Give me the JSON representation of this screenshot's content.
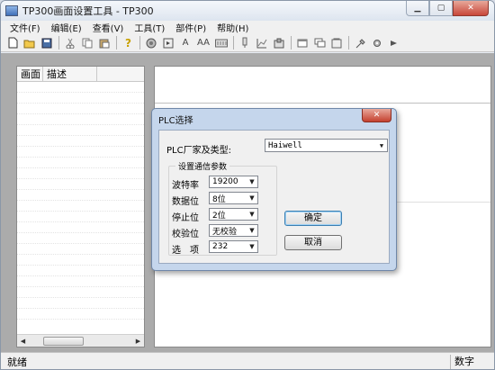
{
  "window": {
    "title": "TP300画面设置工具 - TP300"
  },
  "menu": {
    "items": [
      "文件(F)",
      "编辑(E)",
      "查看(V)",
      "工具(T)",
      "部件(P)",
      "帮助(H)"
    ]
  },
  "toolbar": {
    "items": [
      "new-icon",
      "open-icon",
      "save-icon",
      "cut-icon",
      "copy-icon",
      "paste-icon",
      "help-icon",
      "circle-icon",
      "frame-icon",
      "text-icon",
      "text-large-icon",
      "keypad-icon",
      "lamp-icon",
      "chart-icon",
      "switch-icon",
      "window-icon",
      "window-cascade-icon",
      "bitmap-icon",
      "settings-icon",
      "gear-icon",
      "arrow-icon"
    ],
    "text_icon_glyph": "A",
    "text_large_icon_glyph": "AA"
  },
  "screen_list": {
    "columns": [
      "画面",
      "描述"
    ]
  },
  "status_bar": {
    "left": "就绪",
    "right": "数字"
  },
  "dialog": {
    "title": "PLC选择",
    "plc_label": "PLC厂家及类型:",
    "plc_value": "Haiwell",
    "group_title": "设置通信参数",
    "fields": [
      {
        "label": "波特率",
        "value": "19200"
      },
      {
        "label": "数据位",
        "value": "8位"
      },
      {
        "label": "停止位",
        "value": "2位"
      },
      {
        "label": "校验位",
        "value": "无校验"
      },
      {
        "label": "选　项",
        "value": "232"
      }
    ],
    "ok_label": "确定",
    "cancel_label": "取消"
  }
}
